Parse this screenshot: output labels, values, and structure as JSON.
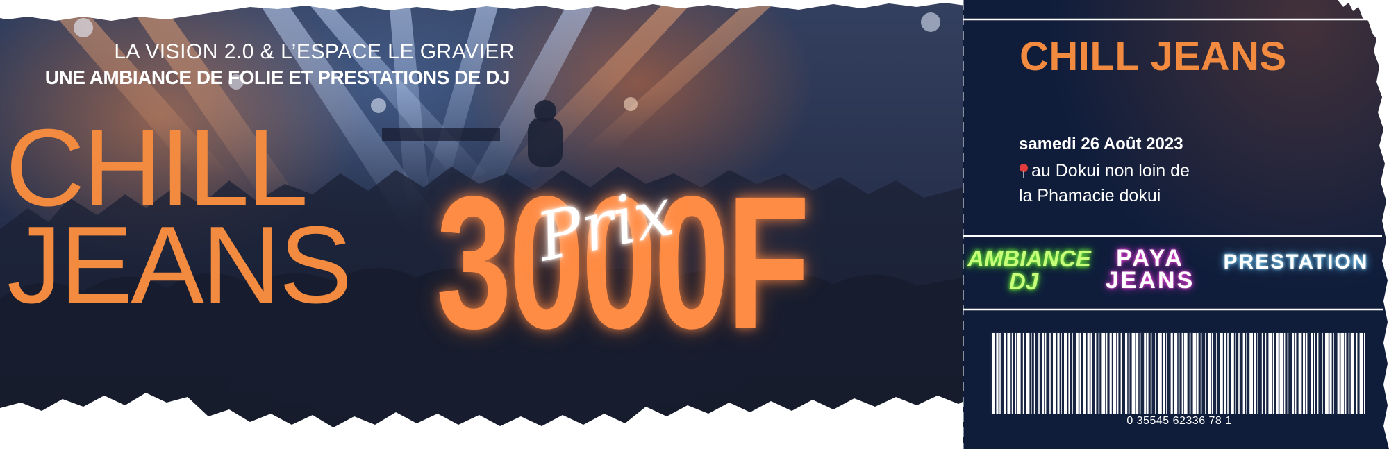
{
  "event": {
    "organizers": "LA VISION 2.0 & L’ESPACE LE GRAVIER",
    "tagline": "UNE AMBIANCE DE FOLIE ET PRESTATIONS DE DJ",
    "title_line1": "CHILL",
    "title_line2": "JEANS",
    "price": "3000F",
    "price_script": "Prix"
  },
  "stub": {
    "title": "CHILL JEANS",
    "date": "samedi 26 Août 2023",
    "location_line1": "au Dokui non loin de",
    "location_line2": "la Phamacie dokui",
    "location_icon": "round-pushpin-icon",
    "badges": {
      "ambiance": [
        "AMBIANCE",
        "DJ"
      ],
      "paya": [
        "PAYA",
        "JEANS"
      ],
      "prestation": "PRESTATION"
    },
    "barcode_number": "0 35545 62336 78 1"
  },
  "colors": {
    "accent_orange": "#f28a3f",
    "stub_navy": "#0f1d3b",
    "neon_green": "#7dff3a",
    "neon_pink": "#ff4fe0",
    "neon_blue": "#52b8ff"
  }
}
